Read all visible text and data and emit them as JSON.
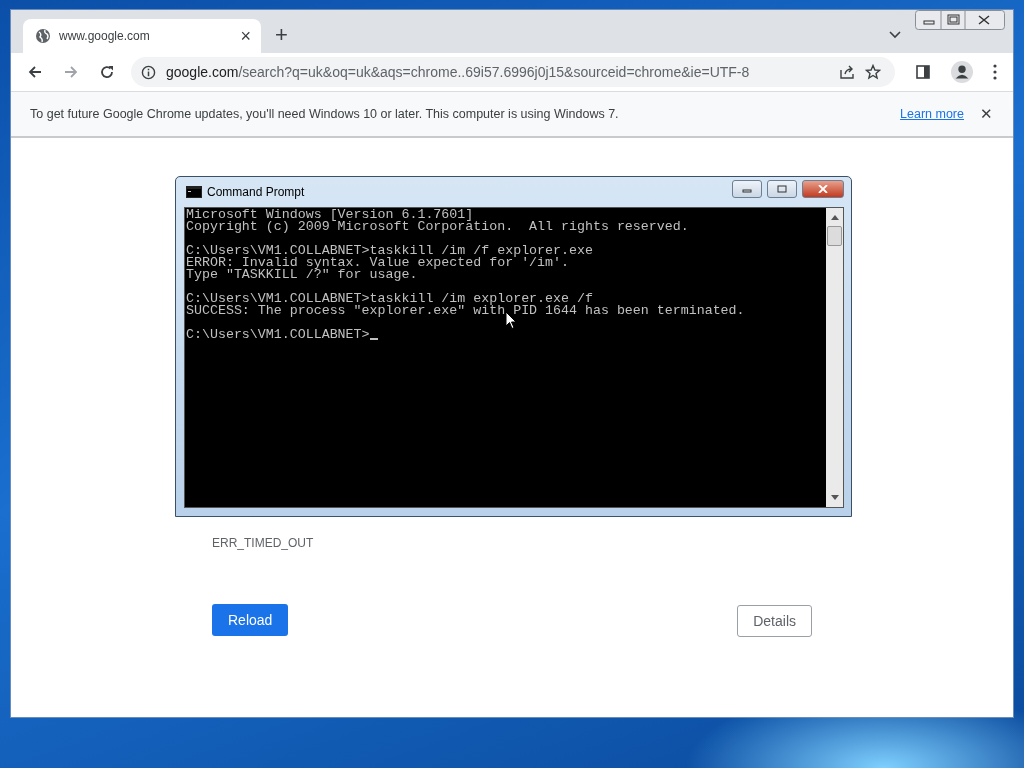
{
  "browser": {
    "tab": {
      "title": "www.google.com",
      "close": "×"
    },
    "new_tab": "+",
    "address": {
      "domain": "google.com",
      "path": "/search?q=uk&oq=uk&aqs=chrome..69i57.6996j0j15&sourceid=chrome&ie=UTF-8"
    },
    "infobar": {
      "message": "To get future Google Chrome updates, you'll need Windows 10 or later. This computer is using Windows 7.",
      "link": "Learn more",
      "close": "✕"
    },
    "error_code": "ERR_TIMED_OUT",
    "buttons": [
      {
        "label": "Reload",
        "kind": "primary"
      },
      {
        "label": "Details",
        "kind": "secondary"
      }
    ]
  },
  "console_window": {
    "title": "Command Prompt",
    "blocks": [
      [
        "Microsoft Windows [Version 6.1.7601]",
        "Copyright (c) 2009 Microsoft Corporation.  All rights reserved."
      ],
      [
        "C:\\Users\\VM1.COLLABNET>taskkill /im /f explorer.exe",
        "ERROR: Invalid syntax. Value expected for '/im'.",
        "Type \"TASKKILL /?\" for usage."
      ],
      [
        "C:\\Users\\VM1.COLLABNET>taskkill /im explorer.exe /f",
        "SUCCESS: The process \"explorer.exe\" with PID 1644 has been terminated."
      ]
    ],
    "prompt": "C:\\Users\\VM1.COLLABNET>"
  }
}
